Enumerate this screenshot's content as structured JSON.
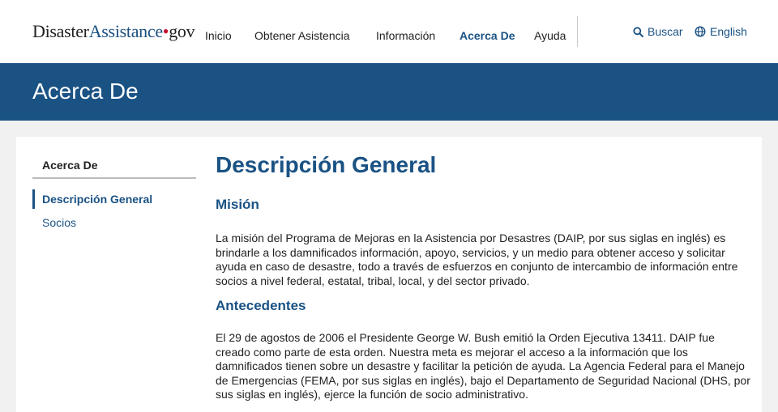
{
  "header": {
    "logo": {
      "part1": "Disaster",
      "part2": "Assistance",
      "dot": "•",
      "part3": "gov"
    },
    "nav": [
      {
        "label": "Inicio",
        "active": false
      },
      {
        "label": "Obtener Asistencia",
        "active": false
      },
      {
        "label": "Información",
        "active": false
      },
      {
        "label": "Acerca De",
        "active": true
      },
      {
        "label": "Ayuda",
        "active": false
      }
    ],
    "search_label": "Buscar",
    "language_label": "English"
  },
  "banner": {
    "title": "Acerca De"
  },
  "sidebar": {
    "heading": "Acerca De",
    "items": [
      {
        "label": "Descripción General",
        "active": true
      },
      {
        "label": "Socios",
        "active": false
      }
    ]
  },
  "main": {
    "title": "Descripción General",
    "sections": [
      {
        "heading": "Misión",
        "body": "La misión del Programa de Mejoras en la Asistencia por Desastres (DAIP, por sus siglas en inglés) es brindarle a los damnificados información, apoyo, servicios, y un medio para obtener acceso y solicitar ayuda en caso de desastre, todo a través de esfuerzos en conjunto de intercambio de información entre socios a nivel federal, estatal, tribal, local, y del sector privado."
      },
      {
        "heading": "Antecedentes",
        "body": "El 29 de agostos de 2006 el Presidente George W. Bush emitió la Orden Ejecutiva 13411. DAIP fue creado como parte de esta orden. Nuestra meta es mejorar el acceso a la información que los damnificados tienen sobre un desastre y facilitar la petición de ayuda. La Agencia Federal para el Manejo de Emergencias (FEMA, por sus siglas en inglés), bajo el Departamento de Seguridad Nacional (DHS, por sus siglas en inglés), ejerce la función de socio administrativo."
      }
    ]
  },
  "colors": {
    "primary": "#1a5284",
    "logo_dot": "#c8102e",
    "page_bg": "#f1f1f1"
  },
  "icons": {
    "search": "search-icon",
    "language": "globe-icon"
  }
}
